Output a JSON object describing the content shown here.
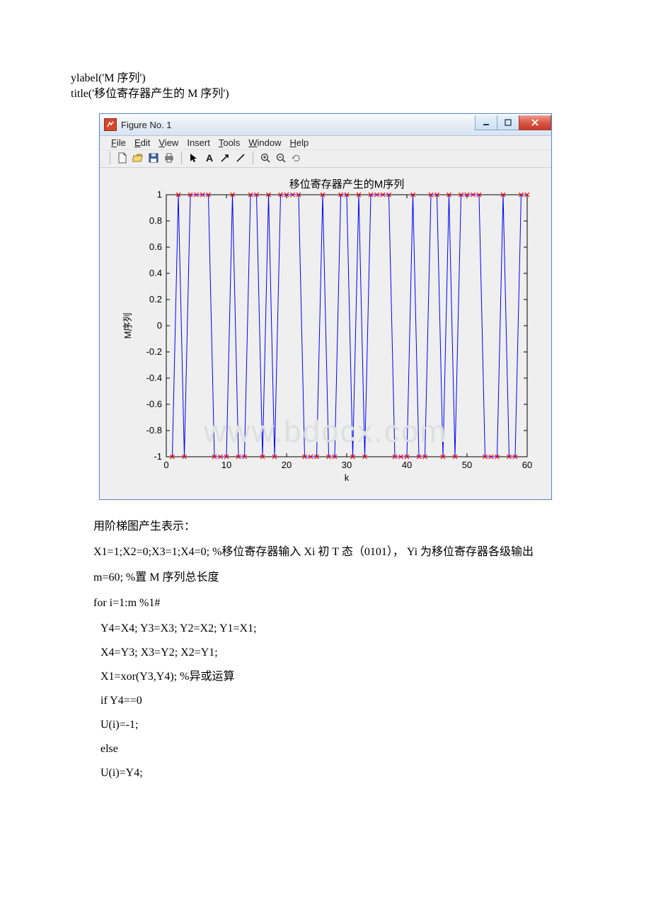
{
  "pre_code": {
    "line1": "ylabel('M 序列')",
    "line2": "title('移位寄存器产生的 M 序列')"
  },
  "window": {
    "title": "Figure No. 1",
    "menu": {
      "file": "File",
      "edit": "Edit",
      "view": "View",
      "insert": "Insert",
      "tools": "Tools",
      "window": "Window",
      "help": "Help"
    },
    "win_btn": {
      "min": "—",
      "max": "▭",
      "close": "X"
    },
    "toolbar_icons": {
      "new": "□",
      "open": "open",
      "save": "save",
      "print": "print",
      "pointer": "pointer",
      "text": "A",
      "arrow": "↗",
      "line": "/",
      "zoomin": "zoom-in",
      "zoomout": "zoom-out",
      "rotate": "rotate"
    }
  },
  "chart_data": {
    "type": "line",
    "title": "移位寄存器产生的M序列",
    "xlabel": "k",
    "ylabel": "M序列",
    "xlim": [
      0,
      60
    ],
    "ylim": [
      -1,
      1
    ],
    "x_ticks": [
      "0",
      "10",
      "20",
      "30",
      "40",
      "50",
      "60"
    ],
    "y_ticks": [
      "-1",
      "-0.8",
      "-0.6",
      "-0.4",
      "-0.2",
      "0",
      "0.2",
      "0.4",
      "0.6",
      "0.8",
      "1"
    ],
    "x": [
      1,
      2,
      3,
      4,
      5,
      6,
      7,
      8,
      9,
      10,
      11,
      12,
      13,
      14,
      15,
      16,
      17,
      18,
      19,
      20,
      21,
      22,
      23,
      24,
      25,
      26,
      27,
      28,
      29,
      30,
      31,
      32,
      33,
      34,
      35,
      36,
      37,
      38,
      39,
      40,
      41,
      42,
      43,
      44,
      45,
      46,
      47,
      48,
      49,
      50,
      51,
      52,
      53,
      54,
      55,
      56,
      57,
      58,
      59,
      60
    ],
    "values": [
      -1,
      1,
      -1,
      1,
      1,
      1,
      1,
      -1,
      -1,
      -1,
      1,
      -1,
      -1,
      1,
      1,
      -1,
      1,
      -1,
      1,
      1,
      1,
      1,
      -1,
      -1,
      -1,
      1,
      -1,
      -1,
      1,
      1,
      -1,
      1,
      -1,
      1,
      1,
      1,
      1,
      -1,
      -1,
      -1,
      1,
      -1,
      -1,
      1,
      1,
      -1,
      1,
      -1,
      1,
      1,
      1,
      1,
      -1,
      -1,
      -1,
      1,
      -1,
      -1,
      1,
      1
    ],
    "marker": "x",
    "line_color": "#0000ff",
    "marker_color": "#ff0000"
  },
  "body": {
    "p1": "用阶梯图产生表示：",
    "p2": "X1=1;X2=0;X3=1;X4=0; %移位寄存器输入 Xi 初 T 态（0101）， Yi 为移位寄存器各级输出",
    "p3": "m=60; %置 M 序列总长度",
    "p4": "for i=1:m %1#",
    "p5": " Y4=X4; Y3=X3; Y2=X2; Y1=X1;",
    "p6": " X4=Y3; X3=Y2; X2=Y1;",
    "p7": " X1=xor(Y3,Y4); %异或运算",
    "p8": " if Y4==0",
    "p9": " U(i)=-1;",
    "p10": " else",
    "p11": " U(i)=Y4;"
  },
  "watermark": "www.bdocx.com"
}
